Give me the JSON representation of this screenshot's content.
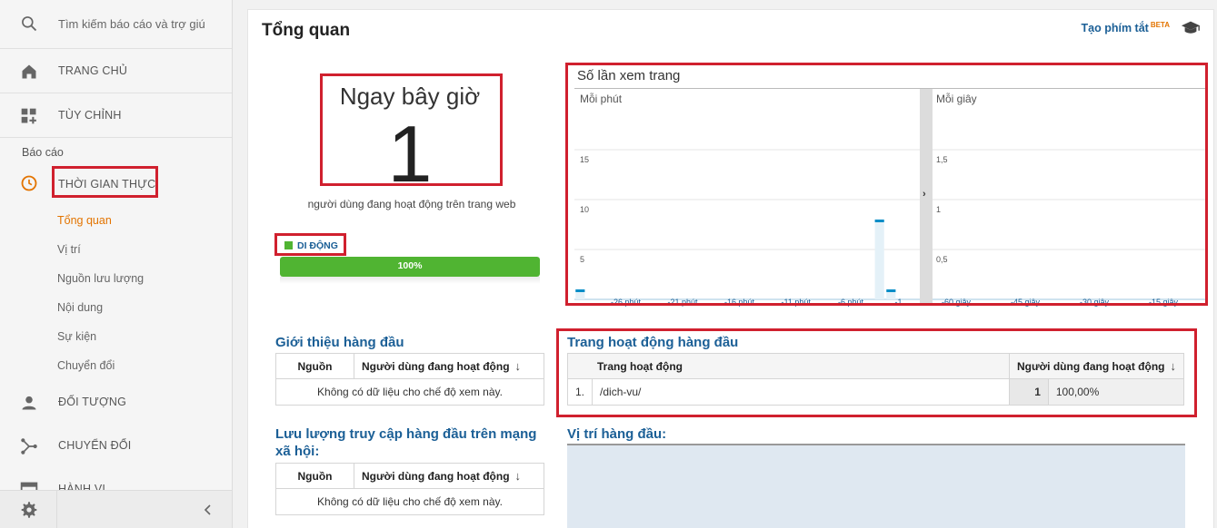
{
  "sidebar": {
    "search_placeholder": "Tìm kiếm báo cáo và trợ giú",
    "home": "TRANG CHỦ",
    "customize": "TÙY CHỈNH",
    "reports_label": "Báo cáo",
    "realtime": "THỜI GIAN THỰC",
    "realtime_items": [
      "Tổng quan",
      "Vị trí",
      "Nguồn lưu lượng",
      "Nội dung",
      "Sự kiện",
      "Chuyển đổi"
    ],
    "audience": "ĐỐI TƯỢNG",
    "acquisition": "CHUYỂN ĐỔI",
    "behavior": "HÀNH VI"
  },
  "header": {
    "title": "Tổng quan",
    "shortcut_label": "Tạo phím tắt",
    "beta": "BETA"
  },
  "now": {
    "label": "Ngay bây giờ",
    "value": "1",
    "description": "người dùng đang hoạt động trên trang web",
    "device_label": "DI ĐỘNG",
    "device_percent": 100,
    "device_percent_text": "100%"
  },
  "colors": {
    "accent_orange": "#e37400",
    "link_blue": "#1b5f96",
    "highlight_red": "#d0202e",
    "mobile_green": "#50b432",
    "series_blue": "#058dc7"
  },
  "chart_data": [
    {
      "type": "bar",
      "title": "Số lần xem trang",
      "subtitle": "Mỗi phút",
      "categories": [
        "-30",
        "-29",
        "-28",
        "-27",
        "-26",
        "-25",
        "-24",
        "-23",
        "-22",
        "-21",
        "-20",
        "-19",
        "-18",
        "-17",
        "-16",
        "-15",
        "-14",
        "-13",
        "-12",
        "-11",
        "-10",
        "-9",
        "-8",
        "-7",
        "-6",
        "-5",
        "-4",
        "-3",
        "-2",
        "-1"
      ],
      "values": [
        1,
        0,
        0,
        0,
        0,
        0,
        0,
        0,
        0,
        0,
        0,
        0,
        0,
        0,
        0,
        0,
        0,
        0,
        0,
        0,
        0,
        0,
        0,
        0,
        0,
        0,
        8,
        1,
        0,
        0
      ],
      "xtick_labels": [
        "-26 phút",
        "-21 phút",
        "-16 phút",
        "-11 phút",
        "-6 phút",
        "-1"
      ],
      "ytick_labels": [
        "5",
        "10",
        "15"
      ],
      "ylim": [
        0,
        20
      ],
      "grid": true
    },
    {
      "type": "bar",
      "subtitle": "Mỗi giây",
      "values": [],
      "xtick_labels": [
        "-60 giây",
        "-45 giây",
        "-30 giây",
        "-15 giây"
      ],
      "ytick_labels": [
        "0,5",
        "1",
        "1,5"
      ],
      "ylim": [
        0,
        2
      ],
      "grid": true
    }
  ],
  "top_referrals": {
    "title": "Giới thiệu hàng đầu",
    "col_source": "Nguồn",
    "col_active": "Người dùng đang hoạt động",
    "empty": "Không có dữ liệu cho chế độ xem này."
  },
  "top_social": {
    "title": "Lưu lượng truy cập hàng đầu trên mạng xã hội:",
    "col_source": "Nguồn",
    "col_active": "Người dùng đang hoạt động",
    "empty": "Không có dữ liệu cho chế độ xem này."
  },
  "top_pages": {
    "title": "Trang hoạt động hàng đầu",
    "col_page": "Trang hoạt động",
    "col_active": "Người dùng đang hoạt động",
    "rows": [
      {
        "num": "1.",
        "page": "/dich-vu/",
        "count": "1",
        "percent": "100,00%"
      }
    ]
  },
  "top_locations": {
    "title": "Vị trí hàng đầu:"
  }
}
